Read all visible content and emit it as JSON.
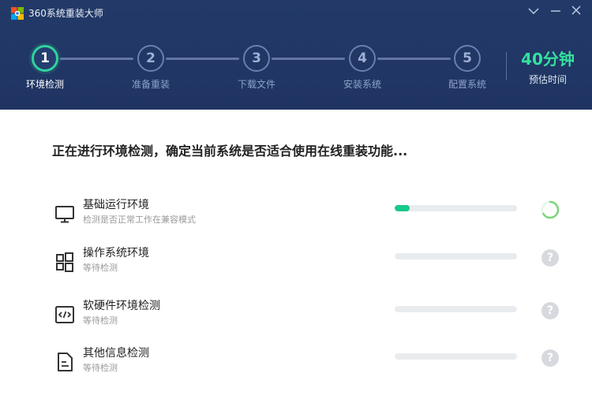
{
  "window": {
    "title": "360系统重装大师"
  },
  "steps": [
    {
      "number": "1",
      "label": "环境检测",
      "state": "active"
    },
    {
      "number": "2",
      "label": "准备重装",
      "state": "pending"
    },
    {
      "number": "3",
      "label": "下载文件",
      "state": "pending"
    },
    {
      "number": "4",
      "label": "安装系统",
      "state": "pending"
    },
    {
      "number": "5",
      "label": "配置系统",
      "state": "pending"
    }
  ],
  "eta": {
    "value": "40分钟",
    "label": "预估时间"
  },
  "main": {
    "headline": "正在进行环境检测，确定当前系统是否适合使用在线重装功能...",
    "checks": [
      {
        "title": "基础运行环境",
        "subtitle": "检测是否正常工作在兼容模式",
        "icon": "monitor-icon",
        "progress_percent": 12,
        "status": "checking"
      },
      {
        "title": "操作系统环境",
        "subtitle": "等待检测",
        "icon": "windows-icon",
        "progress_percent": 0,
        "status": "waiting"
      },
      {
        "title": "软硬件环境检测",
        "subtitle": "等待检测",
        "icon": "code-icon",
        "progress_percent": 0,
        "status": "waiting"
      },
      {
        "title": "其他信息检测",
        "subtitle": "等待检测",
        "icon": "document-icon",
        "progress_percent": 0,
        "status": "waiting"
      }
    ],
    "waiting_status_glyph": "?"
  },
  "colors": {
    "header_bg": "#213866",
    "accent": "#2fd39a",
    "eta": "#34e0a0",
    "progress_fill": "#18c98a",
    "track": "#e9ecef"
  }
}
